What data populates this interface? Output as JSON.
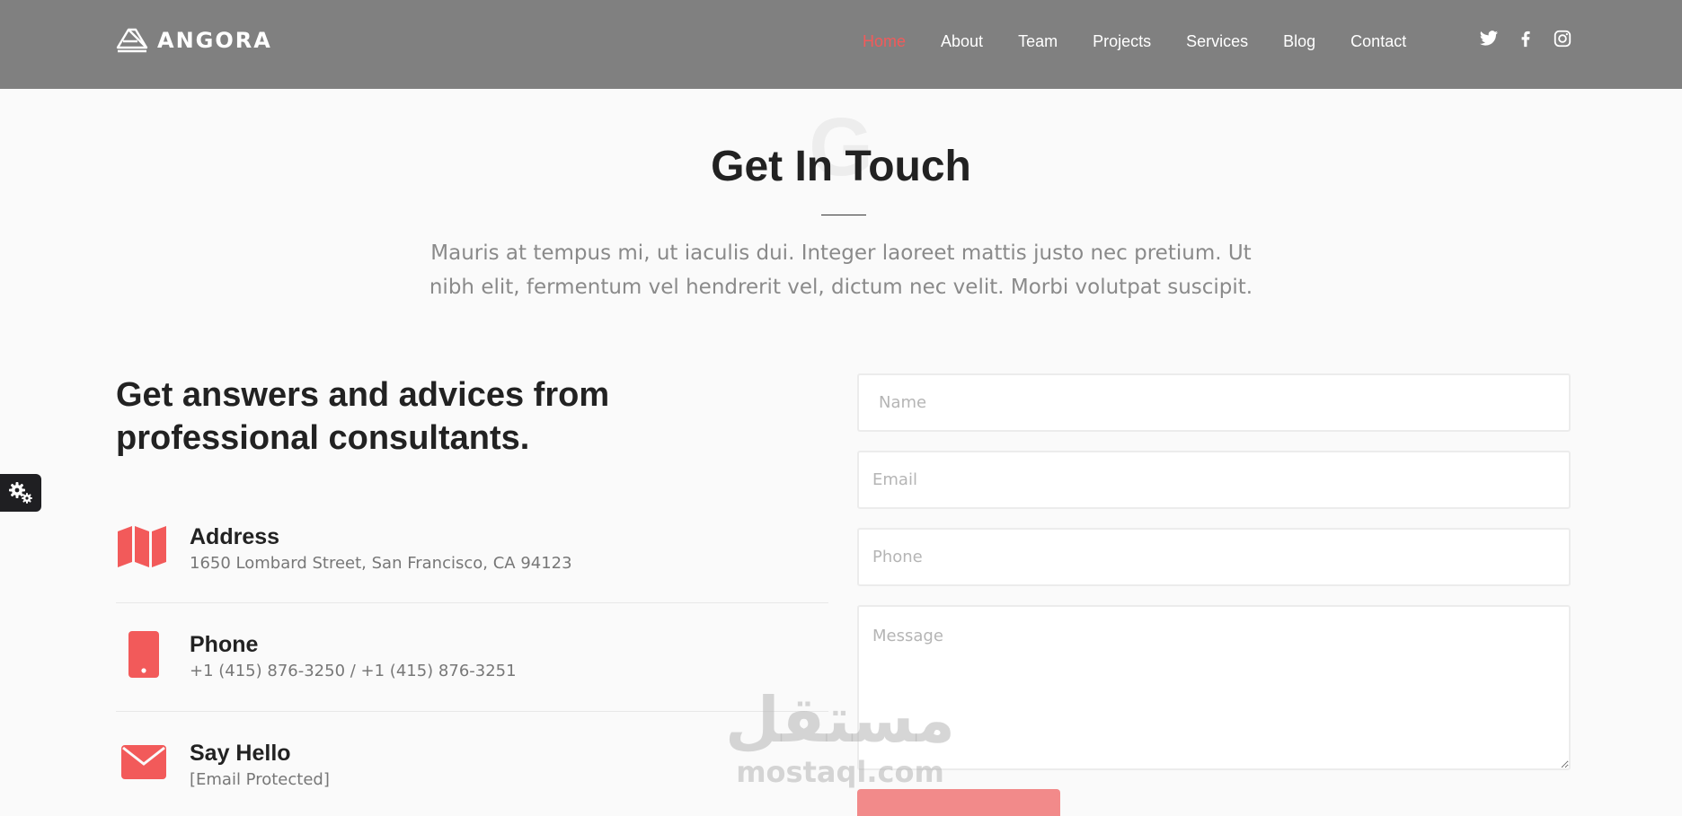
{
  "header": {
    "logo_text": "ANGORA",
    "nav": [
      {
        "label": "Home",
        "active": true
      },
      {
        "label": "About",
        "active": false
      },
      {
        "label": "Team",
        "active": false
      },
      {
        "label": "Projects",
        "active": false
      },
      {
        "label": "Services",
        "active": false
      },
      {
        "label": "Blog",
        "active": false
      },
      {
        "label": "Contact",
        "active": false
      }
    ],
    "social": [
      "twitter-icon",
      "facebook-icon",
      "instagram-icon"
    ]
  },
  "section": {
    "bg_letter": "G",
    "title": "Get In Touch",
    "subtitle": "Mauris at tempus mi, ut iaculis dui. Integer laoreet mattis justo nec pretium. Ut nibh elit, fermentum vel hendrerit vel, dictum nec velit. Morbi volutpat suscipit."
  },
  "info": {
    "heading": "Get answers and advices from professional consultants.",
    "items": [
      {
        "icon": "map-icon",
        "label": "Address",
        "value": "1650 Lombard Street, San Francisco, CA 94123"
      },
      {
        "icon": "phone-icon",
        "label": "Phone",
        "value": "+1 (415) 876-3250 / +1 (415) 876-3251"
      },
      {
        "icon": "envelope-icon",
        "label": "Say Hello",
        "value": "[Email Protected]"
      }
    ]
  },
  "form": {
    "name_placeholder": "Name",
    "email_placeholder": "Email",
    "phone_placeholder": "Phone",
    "message_placeholder": "Message",
    "submit_label": ""
  },
  "watermark": {
    "arabic": "مستقل",
    "latin": "mostaql.com"
  },
  "colors": {
    "accent": "#f25a5a",
    "header_bg": "#808080",
    "page_bg": "#fafafa"
  }
}
